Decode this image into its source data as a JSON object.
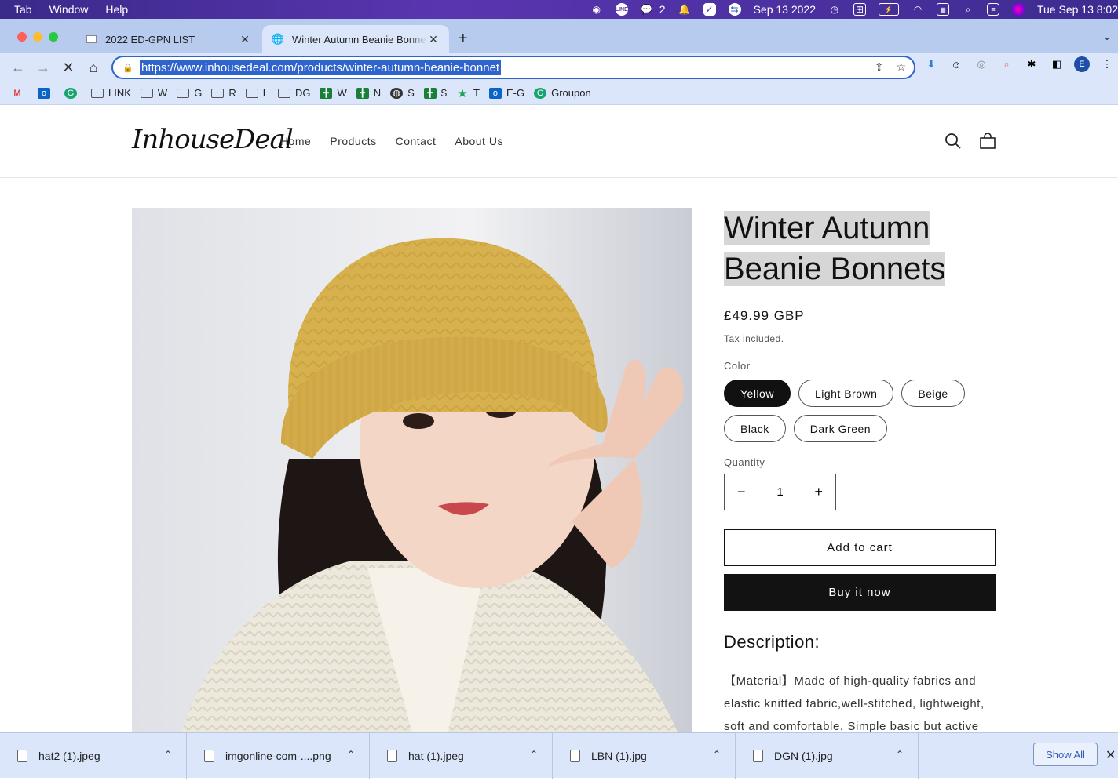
{
  "menubar": {
    "items": [
      "Tab",
      "Window",
      "Help"
    ],
    "wechat_count": "2",
    "date_short": "Sep 13 2022",
    "clock": "Tue Sep 13  8:02"
  },
  "tabs": [
    {
      "title": "2022 ED-GPN LIST",
      "active": false
    },
    {
      "title": "Winter Autumn Beanie Bonnets",
      "active": true
    }
  ],
  "address_bar": {
    "url": "https://www.inhousedeal.com/products/winter-autumn-beanie-bonnet"
  },
  "profile_initial": "E",
  "bookmarks": [
    {
      "label": "",
      "icon": "gmail-icon"
    },
    {
      "label": "",
      "icon": "outlook-icon"
    },
    {
      "label": "",
      "icon": "grammarly-icon"
    },
    {
      "label": "LINK",
      "icon": "folder-icon"
    },
    {
      "label": "W",
      "icon": "folder-icon"
    },
    {
      "label": "G",
      "icon": "folder-icon"
    },
    {
      "label": "R",
      "icon": "folder-icon"
    },
    {
      "label": "L",
      "icon": "folder-icon"
    },
    {
      "label": "DG",
      "icon": "folder-icon"
    },
    {
      "label": "W",
      "icon": "sheets-icon"
    },
    {
      "label": "N",
      "icon": "sheets-icon"
    },
    {
      "label": "S",
      "icon": "globe-icon"
    },
    {
      "label": "$",
      "icon": "sheets-icon"
    },
    {
      "label": "T",
      "icon": "star-icon"
    },
    {
      "label": "E-G",
      "icon": "outlook-icon"
    },
    {
      "label": "Groupon",
      "icon": "grammarly-icon"
    }
  ],
  "site": {
    "logo": "InhouseDeal",
    "nav": [
      "Home",
      "Products",
      "Contact",
      "About Us"
    ]
  },
  "product": {
    "title": "Winter Autumn Beanie Bonnets",
    "price": "£49.99 GBP",
    "tax_note": "Tax included.",
    "color_label": "Color",
    "colors": [
      "Yellow",
      "Light Brown",
      "Beige",
      "Black",
      "Dark Green"
    ],
    "selected_color": "Yellow",
    "quantity_label": "Quantity",
    "quantity": "1",
    "add_to_cart": "Add to cart",
    "buy_now": "Buy it now",
    "description_heading": "Description:",
    "description_text": "【Material】Made of high-quality fabrics and elastic knitted fabric,well-stitched, lightweight, soft and comfortable. Simple basic but active"
  },
  "downloads": {
    "items": [
      "hat2 (1).jpeg",
      "imgonline-com-....png",
      "hat (1).jpeg",
      "LBN (1).jpg",
      "DGN (1).jpg"
    ],
    "show_all": "Show All"
  },
  "colors": {
    "tab_bar": "#b7cbef",
    "toolbar": "#dbe6fb",
    "accent_blue": "#2f64cc",
    "beanie_yellow": "#d8b14f"
  }
}
